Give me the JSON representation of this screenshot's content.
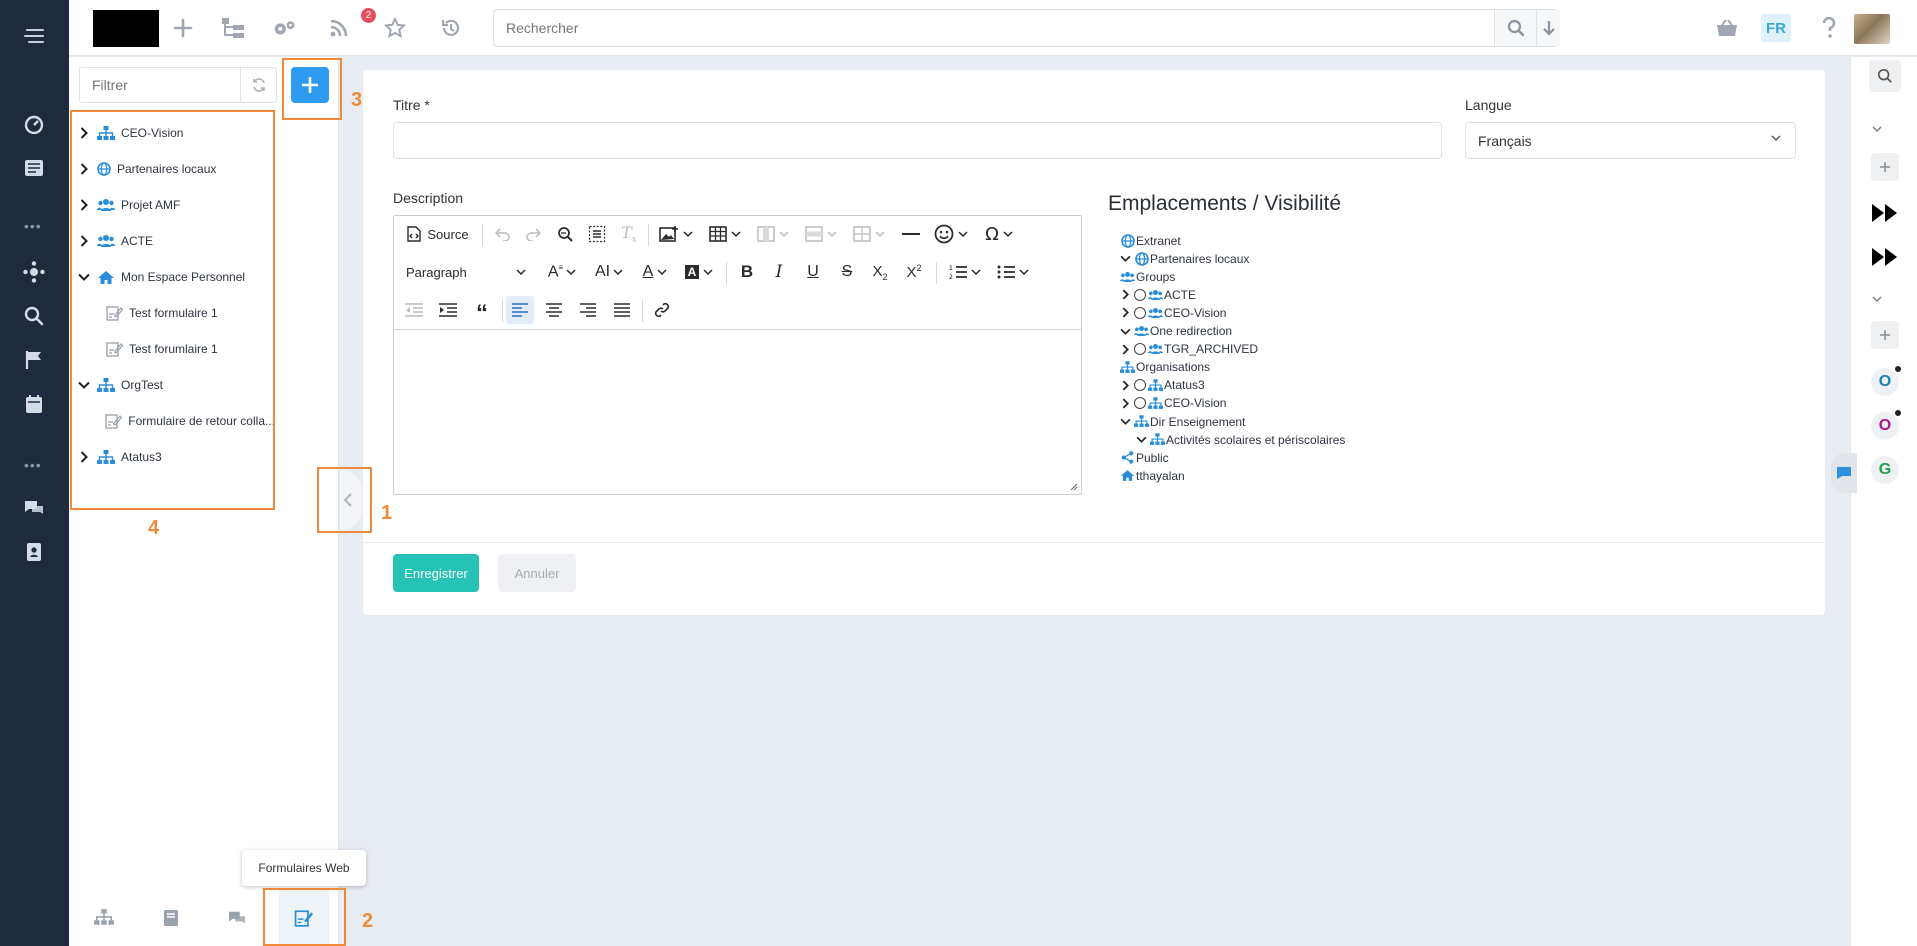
{
  "topbar": {
    "badge_count": "2",
    "search_placeholder": "Rechercher",
    "lang": "FR"
  },
  "tree": {
    "filter_placeholder": "Filtrer",
    "items": [
      {
        "label": "CEO-Vision",
        "icon": "org-icon"
      },
      {
        "label": "Partenaires locaux",
        "icon": "globe-icon"
      },
      {
        "label": "Projet AMF",
        "icon": "users-icon"
      },
      {
        "label": "ACTE",
        "icon": "users-icon"
      },
      {
        "label": "Mon Espace Personnel",
        "icon": "home-icon"
      },
      {
        "label": "Test formulaire 1",
        "icon": "form-icon"
      },
      {
        "label": "Test forumlaire 1",
        "icon": "form-icon"
      },
      {
        "label": "OrgTest",
        "icon": "org-icon"
      },
      {
        "label": "Formulaire de retour colla...",
        "icon": "form-icon"
      },
      {
        "label": "Atatus3",
        "icon": "org-icon"
      }
    ],
    "tooltip": "Formulaires Web"
  },
  "annotations": {
    "n1": "1",
    "n2": "2",
    "n3": "3",
    "n4": "4"
  },
  "form": {
    "titre_label": "Titre *",
    "langue_label": "Langue",
    "langue_value": "Français",
    "description_label": "Description",
    "source_label": "Source",
    "paragraph_label": "Paragraph",
    "save_label": "Enregistrer",
    "cancel_label": "Annuler"
  },
  "visibility": {
    "title": "Emplacements / Visibilité",
    "nodes": [
      {
        "label": "Extranet",
        "icon": "globe-icon",
        "chevron": "",
        "radio": false
      },
      {
        "label": "Partenaires locaux",
        "icon": "globe-icon",
        "chevron": "down",
        "radio": false
      },
      {
        "label": "Groups",
        "icon": "users-icon",
        "chevron": "",
        "radio": false
      },
      {
        "label": "ACTE",
        "icon": "users-icon",
        "chevron": "right",
        "radio": true
      },
      {
        "label": "CEO-Vision",
        "icon": "users-icon",
        "chevron": "right",
        "radio": true
      },
      {
        "label": "One redirection",
        "icon": "users-icon",
        "chevron": "down",
        "radio": false
      },
      {
        "label": "TGR_ARCHIVED",
        "icon": "users-icon",
        "chevron": "right",
        "radio": true
      },
      {
        "label": "Organisations",
        "icon": "org-icon",
        "chevron": "",
        "radio": false
      },
      {
        "label": "Atatus3",
        "icon": "org-icon",
        "chevron": "right",
        "radio": true
      },
      {
        "label": "CEO-Vision",
        "icon": "org-icon",
        "chevron": "right",
        "radio": true
      },
      {
        "label": "Dir Enseignement",
        "icon": "org-icon",
        "chevron": "down",
        "radio": false
      },
      {
        "label": "Activités scolaires et périscolaires",
        "icon": "org-icon",
        "chevron": "down",
        "radio": false
      },
      {
        "label": "Public",
        "icon": "share-icon",
        "chevron": "",
        "radio": false
      },
      {
        "label": "tthayalan",
        "icon": "home-icon",
        "chevron": "",
        "radio": false
      }
    ]
  },
  "right_rail": {
    "letters": [
      {
        "letter": "O",
        "color": "#1b7fb8"
      },
      {
        "letter": "O",
        "color": "#b0128a"
      },
      {
        "letter": "G",
        "color": "#24a148"
      }
    ]
  },
  "colors": {
    "accent": "#2d9cf0",
    "save": "#27c2b6",
    "annotation": "#ee8a3a",
    "rail": "#1f2a3e"
  }
}
